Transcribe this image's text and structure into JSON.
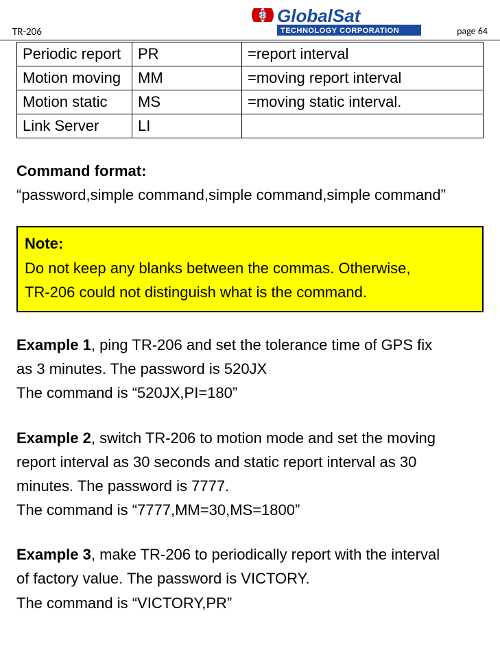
{
  "header": {
    "doc_code": "TR-206",
    "page_label": "page 64",
    "logo_company": "GlobalSat",
    "logo_subtitle": "TECHNOLOGY CORPORATION"
  },
  "table": {
    "rows": [
      {
        "c1": "Periodic report",
        "c2": "PR",
        "c3": "=report interval"
      },
      {
        "c1": "Motion moving",
        "c2": "MM",
        "c3": "=moving report interval"
      },
      {
        "c1": "Motion static",
        "c2": "MS",
        "c3": "=moving static interval."
      },
      {
        "c1": "Link Server",
        "c2": "LI",
        "c3": ""
      }
    ]
  },
  "command_format": {
    "heading": "Command format:",
    "text": "“password,simple command,simple command,simple command”"
  },
  "note": {
    "heading": "Note:",
    "line1": "Do not keep any blanks between the commas. Otherwise,",
    "line2": "TR-206 could not distinguish what is the command."
  },
  "examples": {
    "ex1": {
      "label": "Example 1",
      "rest_line1": ", ping TR-206 and set the tolerance time of GPS fix",
      "line2": "as 3 minutes. The password is 520JX",
      "line3": "The command is “520JX,PI=180”"
    },
    "ex2": {
      "label": "Example 2",
      "rest_line1": ", switch TR-206 to motion mode and set the moving",
      "line2": "report interval as 30 seconds and static report interval as 30",
      "line3": "minutes. The password is 7777.",
      "line4": "The command is “7777,MM=30,MS=1800”"
    },
    "ex3": {
      "label": "Example 3",
      "rest_line1": ", make TR-206 to periodically report with the interval",
      "line2": "of factory value. The password is VICTORY.",
      "line3": "The command is “VICTORY,PR”"
    }
  }
}
